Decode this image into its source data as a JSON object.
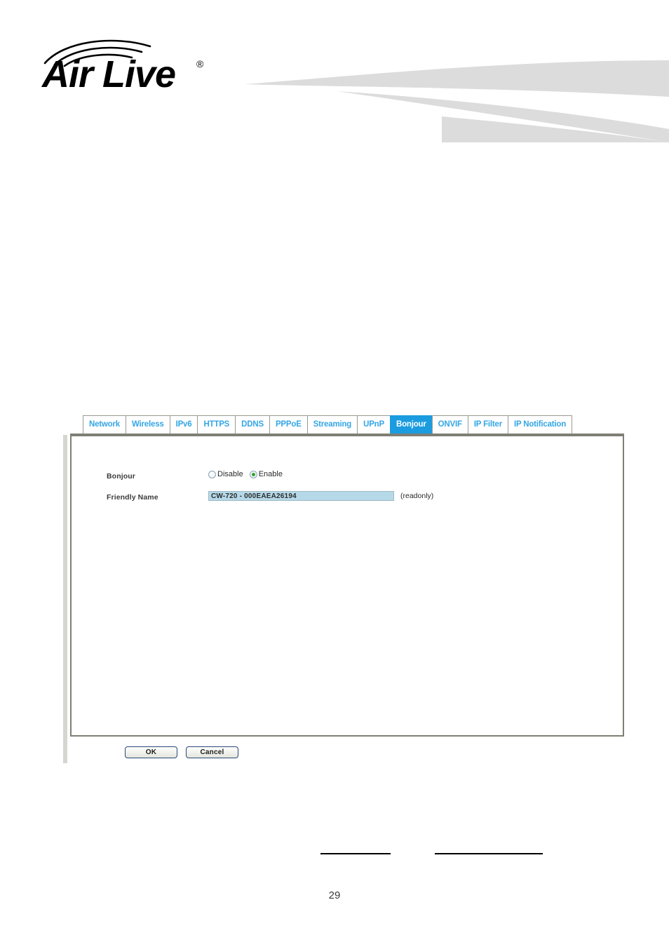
{
  "document": {
    "page_number": "29"
  },
  "branding": {
    "logo_text": "Air Live",
    "logo_trademark": "®",
    "logo_icon": "airlive-logo"
  },
  "colors": {
    "tab_text": "#35a6e5",
    "tab_active_bg": "#1b9ce0",
    "panel_border": "#7f7f75",
    "field_bg": "#b5d9e8",
    "radio_selected": "#2fa52f",
    "swoosh": "#dcdcdc"
  },
  "tabs": [
    {
      "label": "Network",
      "active": false
    },
    {
      "label": "Wireless",
      "active": false
    },
    {
      "label": "IPv6",
      "active": false
    },
    {
      "label": "HTTPS",
      "active": false
    },
    {
      "label": "DDNS",
      "active": false
    },
    {
      "label": "PPPoE",
      "active": false
    },
    {
      "label": "Streaming",
      "active": false
    },
    {
      "label": "UPnP",
      "active": false
    },
    {
      "label": "Bonjour",
      "active": true
    },
    {
      "label": "ONVIF",
      "active": false
    },
    {
      "label": "IP Filter",
      "active": false
    },
    {
      "label": "IP Notification",
      "active": false
    }
  ],
  "form": {
    "bonjour": {
      "label": "Bonjour",
      "options": [
        {
          "label": "Disable",
          "selected": false
        },
        {
          "label": "Enable",
          "selected": true
        }
      ]
    },
    "friendly_name": {
      "label": "Friendly Name",
      "value": "CW-720 - 000EAEA26194",
      "note": "(readonly)"
    }
  },
  "buttons": {
    "ok_label": "OK",
    "cancel_label": "Cancel"
  }
}
